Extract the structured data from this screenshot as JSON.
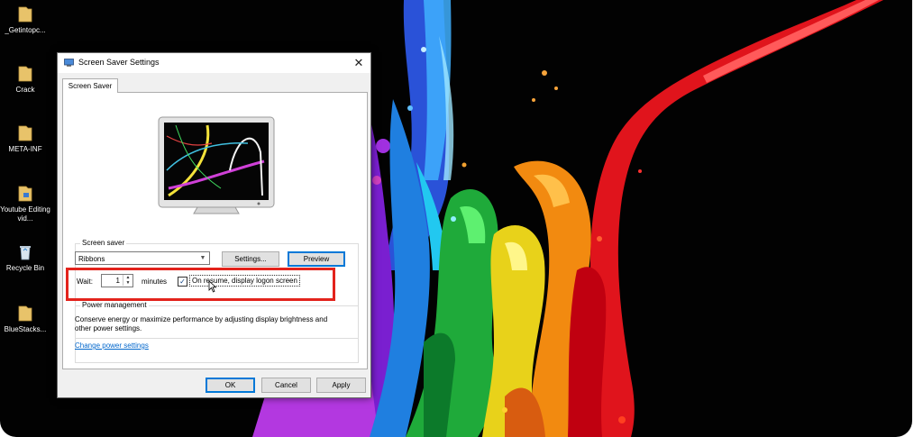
{
  "desktop": {
    "icons": [
      {
        "name": "folder-icon",
        "label": "_Getintopc..."
      },
      {
        "name": "folder-icon",
        "label": "Crack"
      },
      {
        "name": "folder-icon",
        "label": "META-INF"
      },
      {
        "name": "folder-icon",
        "label": "Youtube Editing vid..."
      },
      {
        "name": "recycle-bin-icon",
        "label": "Recycle Bin"
      },
      {
        "name": "folder-icon",
        "label": "BlueStacks..."
      }
    ]
  },
  "dialog": {
    "title": "Screen Saver Settings",
    "close_glyph": "✕",
    "tab_label": "Screen Saver",
    "screen_saver": {
      "group_label": "Screen saver",
      "selected": "Ribbons",
      "settings_label": "Settings...",
      "preview_label": "Preview",
      "wait_label": "Wait:",
      "wait_value": "1",
      "minutes_label": "minutes",
      "on_resume_label": "On resume, display logon screen",
      "on_resume_checked": true
    },
    "power": {
      "group_label": "Power management",
      "description": "Conserve energy or maximize performance by adjusting display brightness and other power settings.",
      "link": "Change power settings"
    },
    "buttons": {
      "ok": "OK",
      "cancel": "Cancel",
      "apply": "Apply"
    }
  },
  "colors": {
    "highlight": "#e3231c",
    "link": "#0066cc",
    "default_button_border": "#0078d7"
  }
}
